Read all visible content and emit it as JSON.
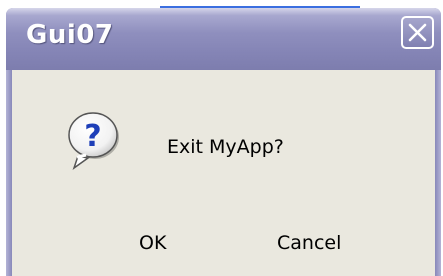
{
  "dialog": {
    "title": "Gui07",
    "message": "Exit MyApp?",
    "icon": "question-icon",
    "ok_label": "OK",
    "cancel_label": "Cancel",
    "close_icon": "close-icon"
  },
  "colors": {
    "titlebar": "#8f8fbe",
    "client_background": "#eae8df",
    "title_text": "#ffffff"
  }
}
